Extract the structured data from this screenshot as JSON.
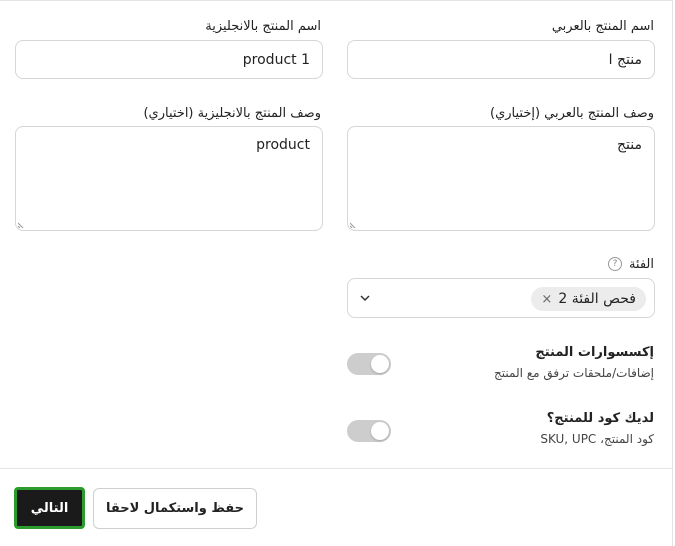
{
  "fields": {
    "name_ar": {
      "label": "اسم المنتج بالعربي",
      "value": "منتج ا"
    },
    "name_en": {
      "label": "اسم المنتج بالانجليزية",
      "value": "product 1"
    },
    "desc_ar": {
      "label": "وصف المنتج بالعربي (إختياري)",
      "value": "منتج"
    },
    "desc_en": {
      "label": "وصف المنتج بالانجليزية (اختياري)",
      "value": "product"
    }
  },
  "category": {
    "label": "الفئة",
    "help_icon": "help-circle-icon",
    "selected_tag": "فحص الفئة 2",
    "remove_glyph": "×"
  },
  "accessories": {
    "title": "إكسسوارات المنتج",
    "subtitle": "إضافات/ملحقات ترفق مع المنتج",
    "toggle_on": false
  },
  "product_code": {
    "title": "لديك كود للمنتج؟",
    "subtitle": "كود المنتج، SKU, UPC",
    "toggle_on": false
  },
  "footer": {
    "save_later_label": "حفظ واستكمال لاحقا",
    "next_label": "التالي"
  },
  "colors": {
    "primary_button": "#1a1a1a",
    "focus_ring": "#2e9b2e",
    "toggle_off": "#cdcdcd"
  }
}
